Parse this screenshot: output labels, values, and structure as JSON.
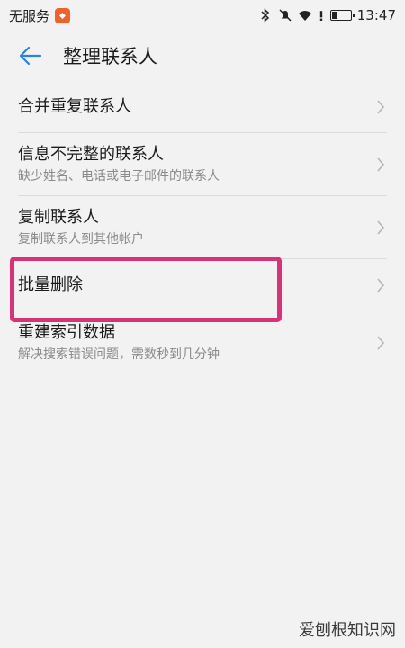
{
  "status_bar": {
    "carrier": "无服务",
    "time": "13:47",
    "icons": [
      "bluetooth-icon",
      "mute-icon",
      "wifi-icon",
      "alert-icon",
      "battery-icon"
    ]
  },
  "header": {
    "title": "整理联系人",
    "back_icon": "back-arrow-icon",
    "accent_color": "#2c82d6"
  },
  "menu": {
    "items": [
      {
        "title": "合并重复联系人",
        "subtitle": ""
      },
      {
        "title": "信息不完整的联系人",
        "subtitle": "缺少姓名、电话或电子邮件的联系人"
      },
      {
        "title": "复制联系人",
        "subtitle": "复制联系人到其他帐户"
      },
      {
        "title": "批量删除",
        "subtitle": ""
      },
      {
        "title": "重建索引数据",
        "subtitle": "解决搜索错误问题，需数秒到几分钟"
      }
    ]
  },
  "highlight": {
    "color": "#d8327a"
  },
  "watermark": {
    "text": "爱刨根知识网"
  }
}
